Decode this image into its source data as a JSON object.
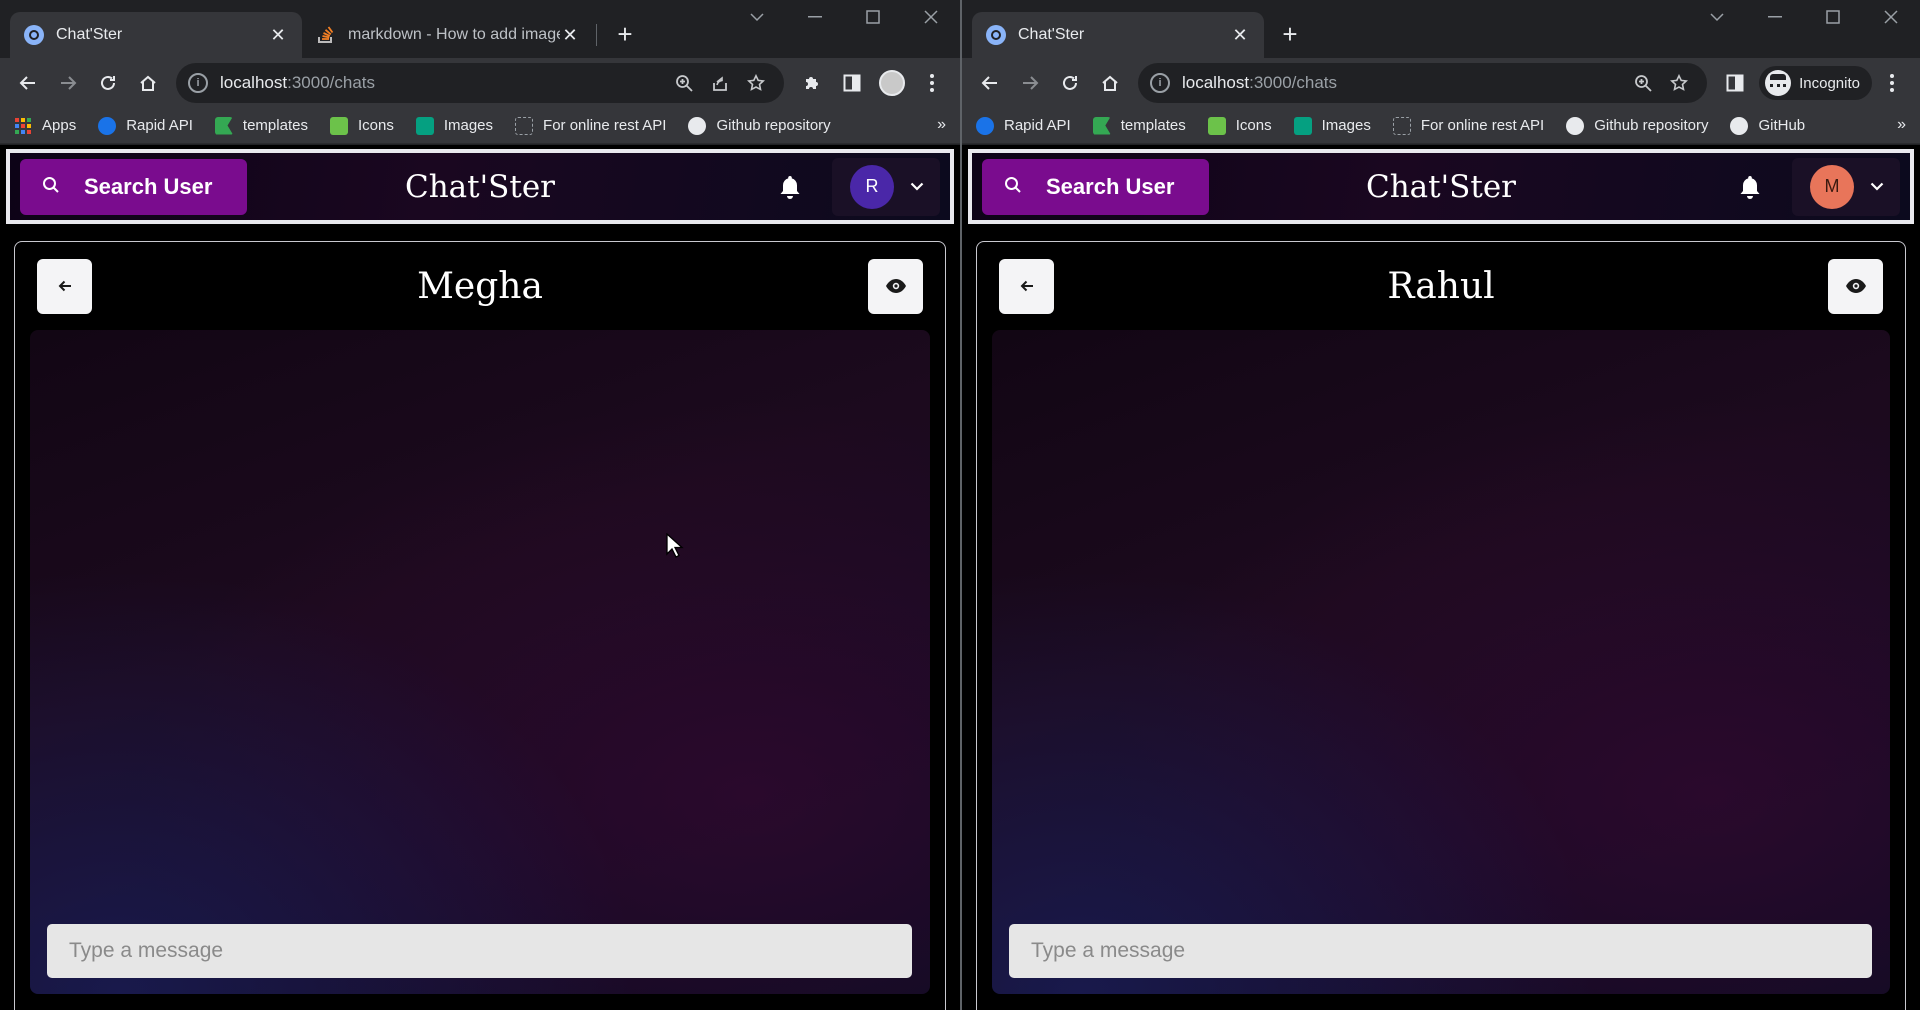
{
  "windows": [
    {
      "tabs": [
        {
          "title": "Chat'Ster",
          "active": true
        },
        {
          "title": "markdown - How to add images",
          "active": false
        }
      ],
      "url_host": "localhost",
      "url_path": ":3000/chats",
      "bookmarks": [
        {
          "label": "Apps",
          "icon": "apps-grid-icon",
          "color": "#ea4335"
        },
        {
          "label": "Rapid API",
          "icon": "rapid-api-icon",
          "color": "#1a73e8"
        },
        {
          "label": "templates",
          "icon": "templates-icon",
          "color": "#34a853"
        },
        {
          "label": "Icons",
          "icon": "icons8-icon",
          "color": "#6cc24a"
        },
        {
          "label": "Images",
          "icon": "pexels-icon",
          "color": "#05a081"
        },
        {
          "label": "For online rest API",
          "icon": "page-icon",
          "color": "#9aa0a6"
        },
        {
          "label": "Github repository",
          "icon": "github-icon",
          "color": "#e8eaed"
        }
      ],
      "header": {
        "search_label": "Search User",
        "brand": "Chat'Ster",
        "avatar_initial": "R",
        "avatar_color": "#4a27a8"
      },
      "chat": {
        "name": "Megha",
        "placeholder": "Type a message"
      }
    },
    {
      "tabs": [
        {
          "title": "Chat'Ster",
          "active": true
        }
      ],
      "url_host": "localhost",
      "url_path": ":3000/chats",
      "incognito_label": "Incognito",
      "bookmarks": [
        {
          "label": "Rapid API",
          "icon": "rapid-api-icon",
          "color": "#1a73e8"
        },
        {
          "label": "templates",
          "icon": "templates-icon",
          "color": "#34a853"
        },
        {
          "label": "Icons",
          "icon": "icons8-icon",
          "color": "#6cc24a"
        },
        {
          "label": "Images",
          "icon": "pexels-icon",
          "color": "#05a081"
        },
        {
          "label": "For online rest API",
          "icon": "page-icon",
          "color": "#9aa0a6"
        },
        {
          "label": "Github repository",
          "icon": "github-icon",
          "color": "#e8eaed"
        },
        {
          "label": "GitHub",
          "icon": "github-icon",
          "color": "#e8eaed"
        }
      ],
      "header": {
        "search_label": "Search User",
        "brand": "Chat'Ster",
        "avatar_initial": "M",
        "avatar_color": "#e8755a"
      },
      "chat": {
        "name": "Rahul",
        "placeholder": "Type a message"
      }
    }
  ],
  "colors": {
    "search_button": "#7a0c8e",
    "header_border": "#e9e9ee"
  }
}
